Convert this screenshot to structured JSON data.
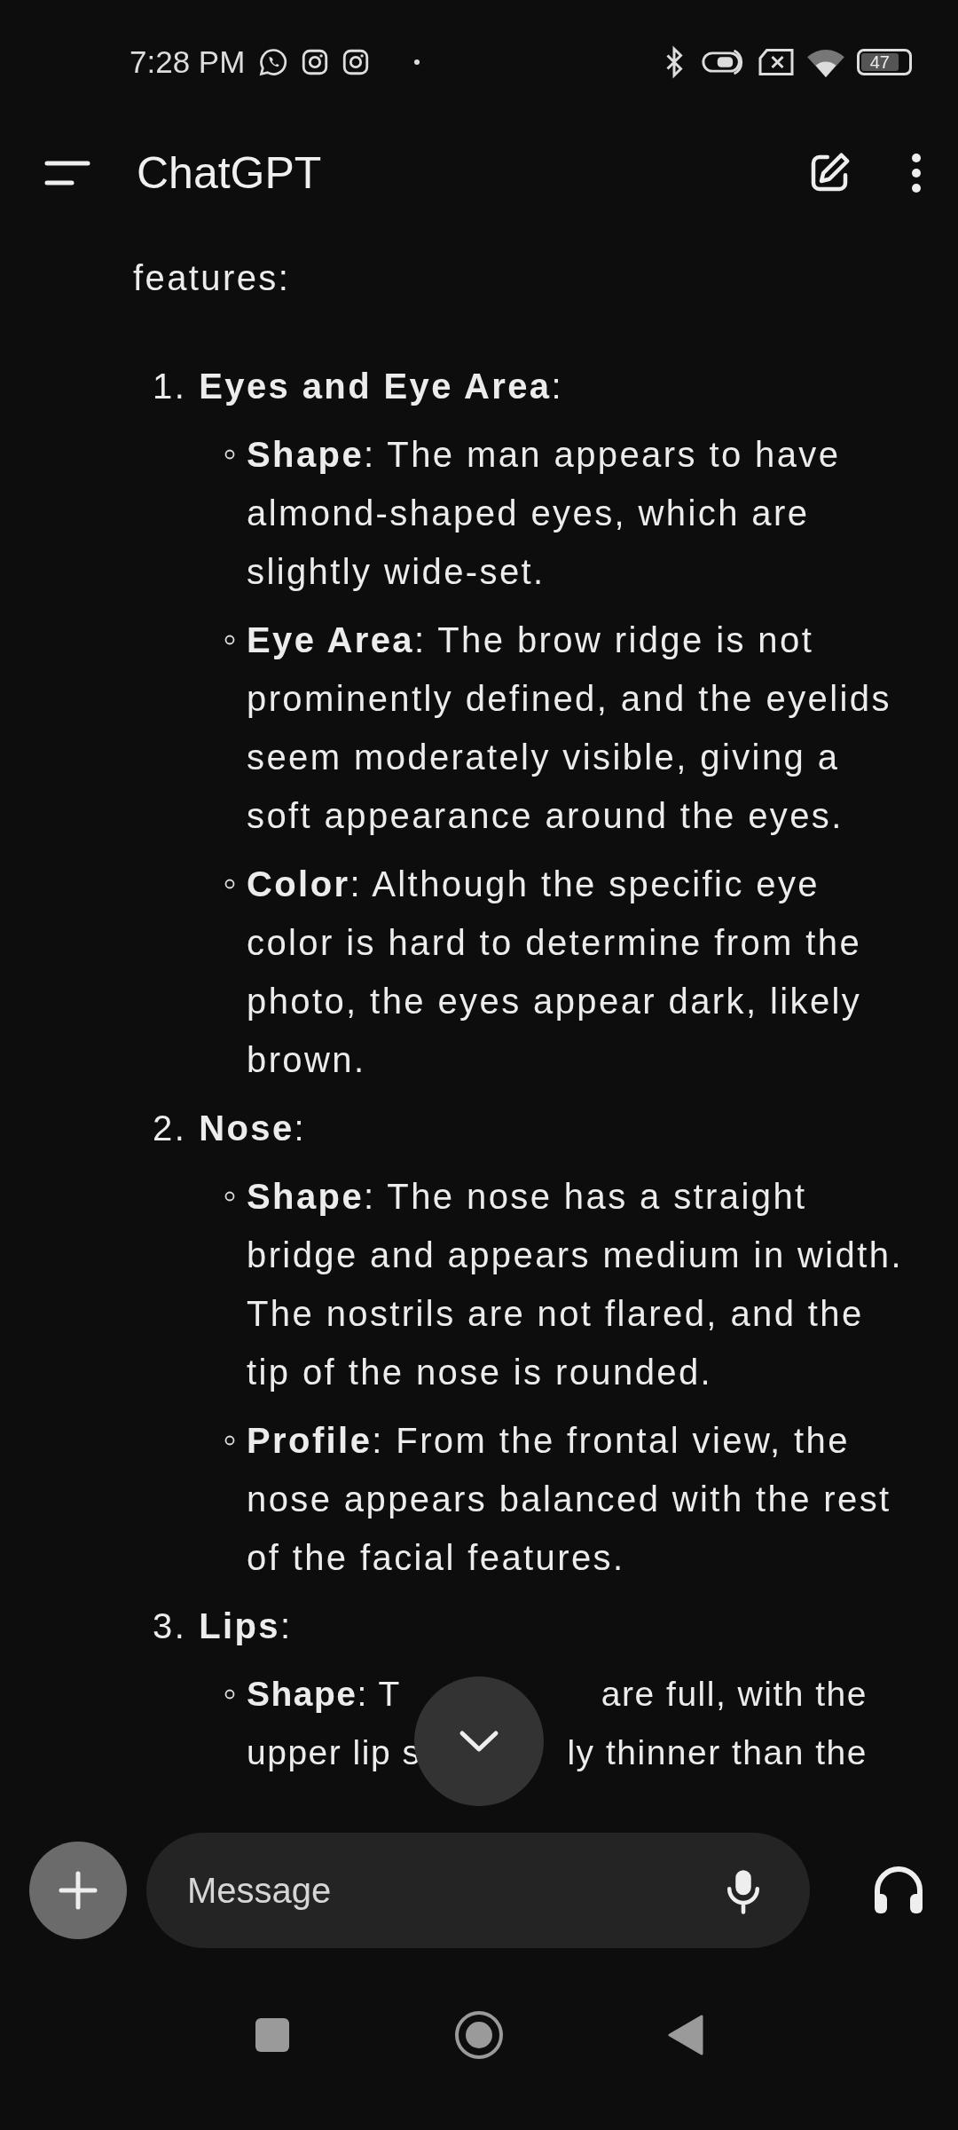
{
  "status_bar": {
    "time": "7:28 PM",
    "battery": "47"
  },
  "header": {
    "title": "ChatGPT"
  },
  "message": {
    "intro": "features:",
    "items": [
      {
        "number": "1.",
        "title": "**Eyes and Eye Area**:",
        "bullets": [
          {
            "kind": "text",
            "text": "**Shape**: The man appears to have almond-shaped eyes, which are slightly wide-set."
          },
          {
            "kind": "text",
            "text": "**Eye Area**: The brow ridge is not prominently defined, and the eyelids seem moderately visible, giving a soft appearance around the eyes."
          },
          {
            "kind": "text",
            "text": "**Color**: Although the specific eye color is hard to determine from the photo, the eyes appear dark, likely brown."
          }
        ]
      },
      {
        "number": "2.",
        "title": "**Nose**:",
        "bullets": [
          {
            "kind": "text",
            "text": "**Shape**: The nose has a straight bridge and appears medium in width. The nostrils are not flared, and the tip of the nose is rounded."
          },
          {
            "kind": "text",
            "text": "**Profile**: From the frontal view, the nose appears balanced with the rest of the facial features."
          }
        ]
      },
      {
        "number": "3.",
        "title": "**Lips**:",
        "bullets": [
          {
            "kind": "covered",
            "lines": [
              {
                "left": "**Shape**: T",
                "right": "are full, with the"
              },
              {
                "left": "upper lip s",
                "right": "ly thinner than the"
              }
            ]
          }
        ]
      }
    ]
  },
  "composer": {
    "placeholder": "Message"
  }
}
